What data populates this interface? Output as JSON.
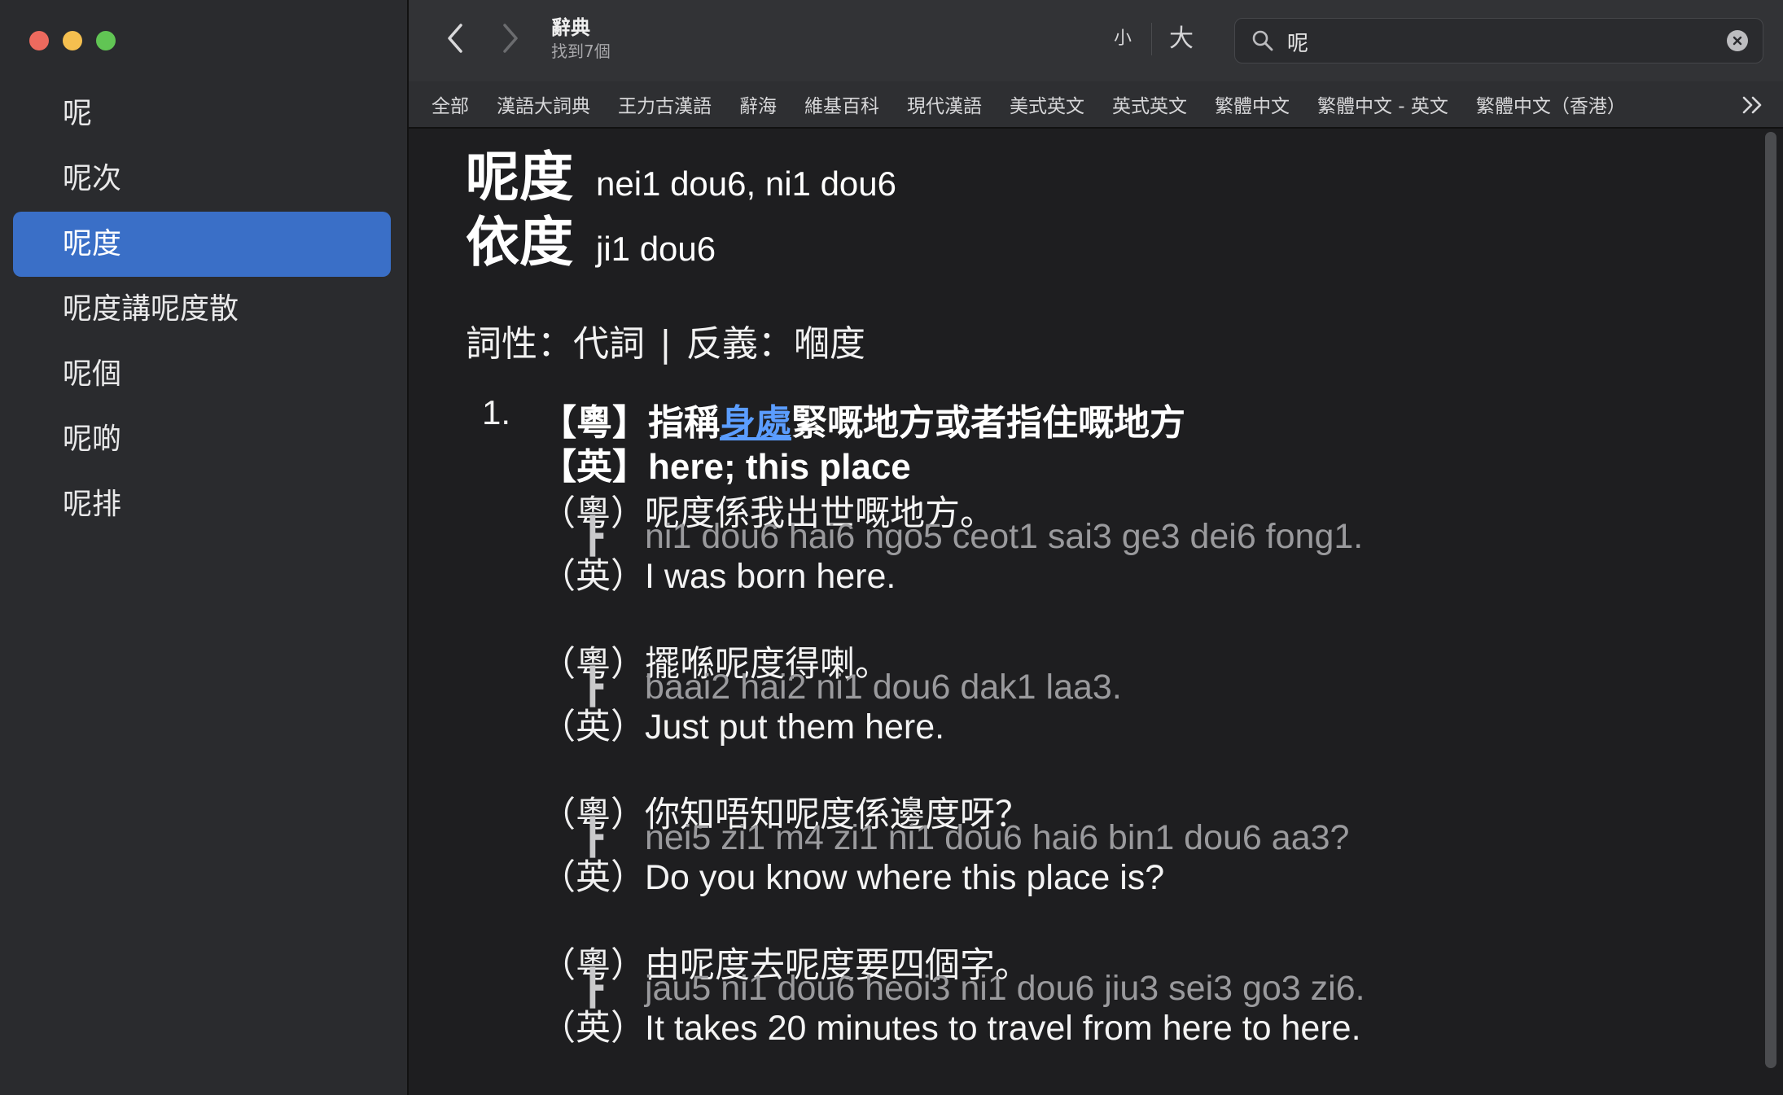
{
  "sidebar": {
    "items": [
      {
        "label": "呢"
      },
      {
        "label": "呢次"
      },
      {
        "label": "呢度",
        "selected": true
      },
      {
        "label": "呢度講呢度散"
      },
      {
        "label": "呢個"
      },
      {
        "label": "呢啲"
      },
      {
        "label": "呢排"
      }
    ]
  },
  "toolbar": {
    "title": "辭典",
    "subtitle": "找到7個",
    "size_small": "小",
    "size_large": "大"
  },
  "search": {
    "value": "呢",
    "placeholder": ""
  },
  "tabs": [
    {
      "label": "全部"
    },
    {
      "label": "漢語大詞典"
    },
    {
      "label": "王力古漢語"
    },
    {
      "label": "辭海"
    },
    {
      "label": "維基百科"
    },
    {
      "label": "現代漢語"
    },
    {
      "label": "美式英文"
    },
    {
      "label": "英式英文"
    },
    {
      "label": "繁體中文"
    },
    {
      "label": "繁體中文 - 英文"
    },
    {
      "label": "繁體中文（香港）"
    }
  ],
  "entry": {
    "headwords": [
      {
        "chars": "呢度",
        "jyutping": "nei1 dou6, ni1 dou6"
      },
      {
        "chars": "依度",
        "jyutping": "ji1 dou6"
      }
    ],
    "pos_label": "詞性：代詞",
    "pos_separator": "|",
    "antonym_label": "反義：嗰度",
    "definition": {
      "number": "1.",
      "yue_tag": "【粵】",
      "yue_before": "指稱",
      "yue_link": "身處",
      "yue_after": "緊嘅地方或者指住嘅地方",
      "en_tag": "【英】",
      "en_text": "here; this place"
    },
    "yue_tag": "（粵）",
    "en_tag": "（英）",
    "rom_mark": "┣",
    "examples": [
      {
        "yue": "呢度係我出世嘅地方。",
        "rom": "ni1 dou6 hai6 ngo5 ceot1 sai3 ge3 dei6 fong1.",
        "en": "I was born here."
      },
      {
        "yue": "擺喺呢度得喇。",
        "rom": "baai2 hai2 ni1 dou6 dak1 laa3.",
        "en": "Just put them here."
      },
      {
        "yue": "你知唔知呢度係邊度呀？",
        "rom": "nei5 zi1 m4 zi1 ni1 dou6 hai6 bin1 dou6 aa3?",
        "en": "Do you know where this place is?"
      },
      {
        "yue": "由呢度去呢度要四個字。",
        "rom": "jau5 ni1 dou6 heoi3 ni1 dou6 jiu3 sei3 go3 zi6.",
        "en": "It takes 20 minutes to travel from here to here."
      }
    ]
  },
  "colors": {
    "accent": "#3a6fc7",
    "link": "#5b9dff",
    "romanization": "#9a9a9d"
  }
}
